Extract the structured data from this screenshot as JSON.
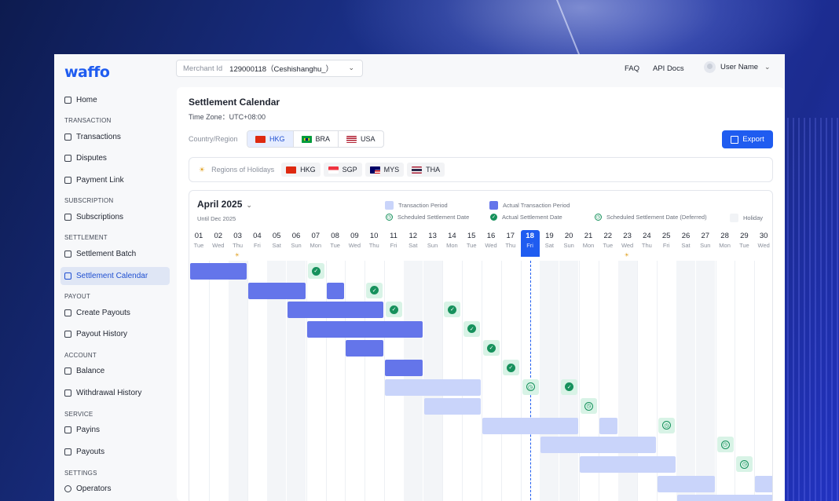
{
  "brand": {
    "logo": "waffo",
    "accent": "#1f5cf0"
  },
  "sidebar": {
    "groups": {
      "transaction": "TRANSACTION",
      "subscription": "SUBSCRIPTION",
      "settlement": "SETTLEMENT",
      "payout": "PAYOUT",
      "account": "ACCOUNT",
      "service": "SERVICE",
      "settings": "SETTINGS"
    },
    "items": {
      "home": "Home",
      "transactions": "Transactions",
      "disputes": "Disputes",
      "payment_link": "Payment Link",
      "subscriptions": "Subscriptions",
      "settlement_batch": "Settlement Batch",
      "settlement_calendar": "Settlement Calendar",
      "create_payouts": "Create Payouts",
      "payout_history": "Payout History",
      "balance": "Balance",
      "withdrawal_history": "Withdrawal History",
      "payins": "Payins",
      "payouts": "Payouts",
      "operators": "Operators"
    },
    "active": "settlement_calendar"
  },
  "topbar": {
    "merchant_label": "Merchant Id",
    "merchant_value": "129000118（Ceshishanghu_）",
    "faq": "FAQ",
    "api_docs": "API Docs",
    "user_name": "User Name"
  },
  "page": {
    "title": "Settlement Calendar",
    "timezone": "Time Zone：UTC+08:00",
    "country_label": "Country/Region",
    "countries": [
      "HKG",
      "BRA",
      "USA"
    ],
    "selected_country": "HKG",
    "export_label": "Export",
    "holidays_label": "Regions of Holidays",
    "holiday_regions": [
      "HKG",
      "SGP",
      "MYS",
      "THA"
    ]
  },
  "calendar": {
    "month": "April 2025",
    "until": "Until Dec 2025",
    "legend": {
      "transaction_period": "Transaction Period",
      "actual_transaction_period": "Actual Transaction Period",
      "scheduled_settlement": "Scheduled Settlement Date",
      "actual_settlement": "Actual Settlement Date",
      "scheduled_deferred": "Scheduled Settlement Date (Deferred)",
      "holiday": "Holiday"
    },
    "days": [
      {
        "n": "01",
        "w": "Tue"
      },
      {
        "n": "02",
        "w": "Wed"
      },
      {
        "n": "03",
        "w": "Thu"
      },
      {
        "n": "04",
        "w": "Fri"
      },
      {
        "n": "05",
        "w": "Sat"
      },
      {
        "n": "06",
        "w": "Sun"
      },
      {
        "n": "07",
        "w": "Mon"
      },
      {
        "n": "08",
        "w": "Tue"
      },
      {
        "n": "09",
        "w": "Wed"
      },
      {
        "n": "10",
        "w": "Thu"
      },
      {
        "n": "11",
        "w": "Fri"
      },
      {
        "n": "12",
        "w": "Sat"
      },
      {
        "n": "13",
        "w": "Sun"
      },
      {
        "n": "14",
        "w": "Mon"
      },
      {
        "n": "15",
        "w": "Tue"
      },
      {
        "n": "16",
        "w": "Wed"
      },
      {
        "n": "17",
        "w": "Thu"
      },
      {
        "n": "18",
        "w": "Fri"
      },
      {
        "n": "19",
        "w": "Sat"
      },
      {
        "n": "20",
        "w": "Sun"
      },
      {
        "n": "21",
        "w": "Mon"
      },
      {
        "n": "22",
        "w": "Tue"
      },
      {
        "n": "23",
        "w": "Wed"
      },
      {
        "n": "24",
        "w": "Thu"
      },
      {
        "n": "25",
        "w": "Fri"
      },
      {
        "n": "26",
        "w": "Sat"
      },
      {
        "n": "27",
        "w": "Sun"
      },
      {
        "n": "28",
        "w": "Mon"
      },
      {
        "n": "29",
        "w": "Tue"
      },
      {
        "n": "30",
        "w": "Wed"
      }
    ],
    "today_day": 18,
    "holiday_days": [
      3,
      23
    ],
    "weekend_days": [
      5,
      6,
      12,
      13,
      19,
      20,
      26,
      27
    ],
    "holiday_shaded_days": [
      3,
      23
    ],
    "bars": [
      {
        "type": "actual",
        "start": 1,
        "end": 3,
        "row": 0
      },
      {
        "type": "actual",
        "start": 4,
        "end": 6,
        "row": 1
      },
      {
        "type": "actual",
        "start": 8,
        "end": 8,
        "row": 1
      },
      {
        "type": "actual",
        "start": 6,
        "end": 10,
        "row": 2
      },
      {
        "type": "actual",
        "start": 7,
        "end": 12,
        "row": 3
      },
      {
        "type": "actual",
        "start": 9,
        "end": 10,
        "row": 4
      },
      {
        "type": "actual",
        "start": 11,
        "end": 12,
        "row": 5
      },
      {
        "type": "period",
        "start": 11,
        "end": 15,
        "row": 6
      },
      {
        "type": "period",
        "start": 13,
        "end": 15,
        "row": 7
      },
      {
        "type": "period",
        "start": 16,
        "end": 20,
        "row": 8
      },
      {
        "type": "period",
        "start": 22,
        "end": 22,
        "row": 8
      },
      {
        "type": "period",
        "start": 19,
        "end": 24,
        "row": 9
      },
      {
        "type": "period",
        "start": 21,
        "end": 25,
        "row": 10
      },
      {
        "type": "period",
        "start": 25,
        "end": 27,
        "row": 11
      },
      {
        "type": "period",
        "start": 30,
        "end": 30,
        "row": 11
      },
      {
        "type": "period",
        "start": 26,
        "end": 30,
        "row": 12
      }
    ],
    "markers": [
      {
        "type": "actual",
        "day": 7,
        "row": 0
      },
      {
        "type": "actual",
        "day": 10,
        "row": 1
      },
      {
        "type": "actual",
        "day": 11,
        "row": 2
      },
      {
        "type": "actual",
        "day": 14,
        "row": 2
      },
      {
        "type": "actual",
        "day": 15,
        "row": 3
      },
      {
        "type": "actual",
        "day": 16,
        "row": 4
      },
      {
        "type": "actual",
        "day": 17,
        "row": 5
      },
      {
        "type": "deferred",
        "day": 18,
        "row": 6
      },
      {
        "type": "actual",
        "day": 20,
        "row": 6
      },
      {
        "type": "deferred",
        "day": 21,
        "row": 7
      },
      {
        "type": "deferred",
        "day": 25,
        "row": 8
      },
      {
        "type": "deferred",
        "day": 28,
        "row": 9
      },
      {
        "type": "deferred",
        "day": 29,
        "row": 10
      }
    ]
  }
}
